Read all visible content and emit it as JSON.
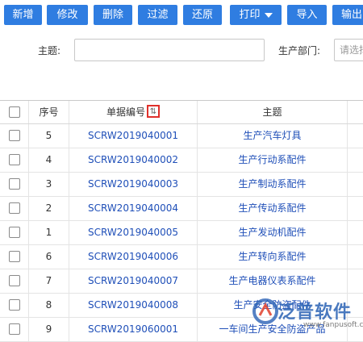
{
  "toolbar": {
    "buttons": [
      {
        "label": "新增"
      },
      {
        "label": "修改"
      },
      {
        "label": "删除"
      },
      {
        "label": "过滤"
      },
      {
        "label": "还原"
      },
      {
        "label": "打印"
      },
      {
        "label": "导入"
      },
      {
        "label": "输出"
      }
    ]
  },
  "filter": {
    "subject_label": "主题:",
    "subject_value": "",
    "dept_label": "生产部门:",
    "dept_placeholder": "请选择"
  },
  "table": {
    "headers": {
      "seq": "序号",
      "doc_no": "单据编号",
      "subject": "主题"
    },
    "rows": [
      {
        "seq": "5",
        "doc_no": "SCRW2019040001",
        "subject": "生产汽车灯具"
      },
      {
        "seq": "4",
        "doc_no": "SCRW2019040002",
        "subject": "生产行动系配件"
      },
      {
        "seq": "3",
        "doc_no": "SCRW2019040003",
        "subject": "生产制动系配件"
      },
      {
        "seq": "2",
        "doc_no": "SCRW2019040004",
        "subject": "生产传动系配件"
      },
      {
        "seq": "1",
        "doc_no": "SCRW2019040005",
        "subject": "生产发动机配件"
      },
      {
        "seq": "6",
        "doc_no": "SCRW2019040006",
        "subject": "生产转向系配件"
      },
      {
        "seq": "7",
        "doc_no": "SCRW2019040007",
        "subject": "生产电器仪表系配件"
      },
      {
        "seq": "8",
        "doc_no": "SCRW2019040008",
        "subject": "生产安全防盗配件"
      },
      {
        "seq": "9",
        "doc_no": "SCRW2019060001",
        "subject": "一车间生产安全防盗产品"
      }
    ]
  },
  "watermark": {
    "text": "泛普软件",
    "url": "www.fanpusoft.com"
  },
  "colors": {
    "button_bg": "#2f7de1",
    "link": "#1f4fb8",
    "sort_highlight": "#e0302b"
  }
}
